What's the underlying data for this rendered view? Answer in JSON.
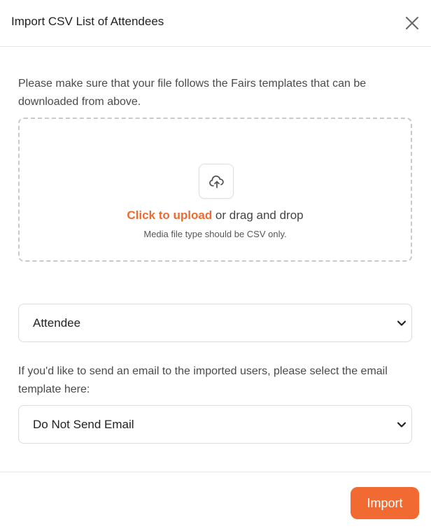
{
  "modal": {
    "title": "Import CSV List of Attendees",
    "close_icon": "close-icon"
  },
  "intro": {
    "text": "Please make sure that your file follows the Fairs templates that can be downloaded from above."
  },
  "upload": {
    "icon": "upload-cloud-icon",
    "link_text": "Click to upload",
    "rest_text": " or drag and drop",
    "hint": "Media file type should be CSV only."
  },
  "role_select": {
    "value": "Attendee"
  },
  "email_section": {
    "text": "If you'd like to send an email to the imported users, please select the email template here:",
    "select_value": "Do Not Send Email"
  },
  "footer": {
    "import_label": "Import"
  },
  "colors": {
    "accent": "#f06a32",
    "link": "#ee6a2f"
  }
}
